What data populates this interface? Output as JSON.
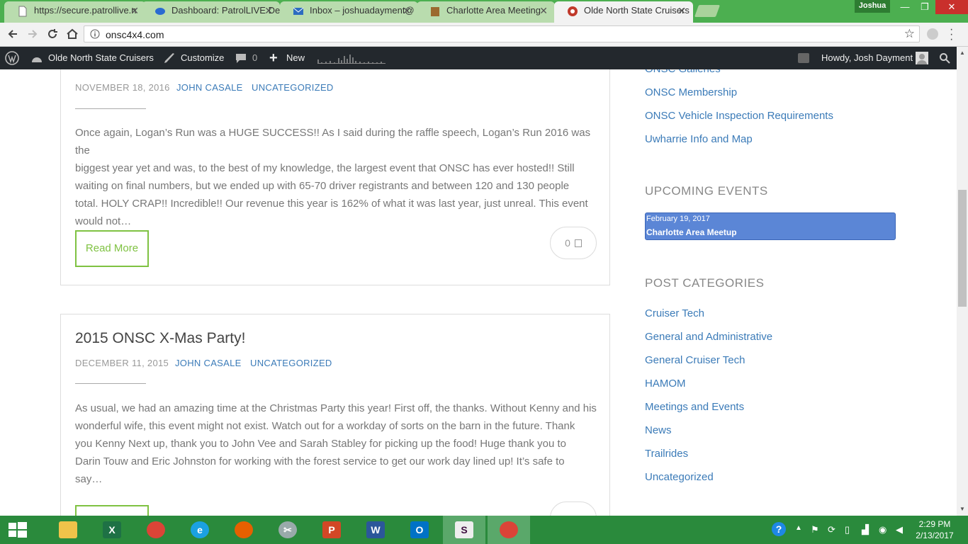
{
  "browser": {
    "tabs": [
      {
        "title": "https://secure.patrollive.n",
        "icon": "page-icon"
      },
      {
        "title": "Dashboard: PatrolLIVE Dev",
        "icon": "dashboard-icon"
      },
      {
        "title": "Inbox – joshuadayment@",
        "icon": "mail-icon"
      },
      {
        "title": "Charlotte Area Meeting",
        "icon": "calendar-icon"
      },
      {
        "title": "Olde North State Cruisers",
        "icon": "site-icon"
      }
    ],
    "profile_name": "Joshua",
    "url": "onsc4x4.com"
  },
  "adminbar": {
    "site_name": "Olde North State Cruisers",
    "customize": "Customize",
    "comments_count": "0",
    "new_label": "New",
    "howdy": "Howdy, Josh Dayment"
  },
  "posts": [
    {
      "date": "NOVEMBER 18, 2016",
      "author": "JOHN CASALE",
      "category": "UNCATEGORIZED",
      "excerpt": [
        "Once again, Logan’s Run was a HUGE SUCCESS!!  As I said during the raffle speech, Logan’s Run 2016 was the",
        "biggest year yet and was, to the best of my knowledge, the largest event that ONSC has ever hosted!!  Still",
        "waiting on final numbers, but we ended up with 65-70 driver registrants and between 120 and 130 people",
        "total.  HOLY CRAP!!  Incredible!!  Our revenue this year is 162% of what it was last year, just unreal. This event",
        "would not…"
      ],
      "read_more": "Read More",
      "comments": "0"
    },
    {
      "title": "2015 ONSC X-Mas Party!",
      "date": "DECEMBER 11, 2015",
      "author": "JOHN CASALE",
      "category": "UNCATEGORIZED",
      "excerpt": [
        "As usual, we had an amazing time at the Christmas Party this year! First off, the thanks.  Without Kenny and his",
        "wonderful wife, this event might not exist.  Watch out for a workday of sorts on the barn in the future.  Thank",
        "you Kenny Next up, thank you to John Vee and Sarah Stabley for picking up the food! Huge thank you to",
        "Darin Touw and Eric Johnston for working with the forest service to get our work day lined up!  It’s safe to",
        "say…"
      ]
    }
  ],
  "sidebar": {
    "pages": [
      "ONSC Galleries",
      "ONSC Membership",
      "ONSC Vehicle Inspection Requirements",
      "Uwharrie Info and Map"
    ],
    "upcoming_heading": "UPCOMING EVENTS",
    "event": {
      "date": "February 19, 2017",
      "title": "Charlotte Area Meetup"
    },
    "categories_heading": "POST CATEGORIES",
    "categories": [
      "Cruiser Tech",
      "General and Administrative",
      "General Cruiser Tech",
      "HAMOM",
      "Meetings and Events",
      "News",
      "Trailrides",
      "Uncategorized"
    ]
  },
  "taskbar": {
    "apps": [
      "file-explorer",
      "excel",
      "chrome",
      "internet-explorer",
      "firefox",
      "snipping-tool",
      "powerpoint",
      "word",
      "outlook",
      "slack",
      "chrome-window"
    ],
    "time": "2:29 PM",
    "date": "2/13/2017"
  },
  "colors": {
    "link": "#3b7bb8",
    "accent_green": "#7fc242",
    "event_bg": "#5b86d6",
    "taskbar": "#2a8a3c",
    "adminbar": "#23282d"
  }
}
